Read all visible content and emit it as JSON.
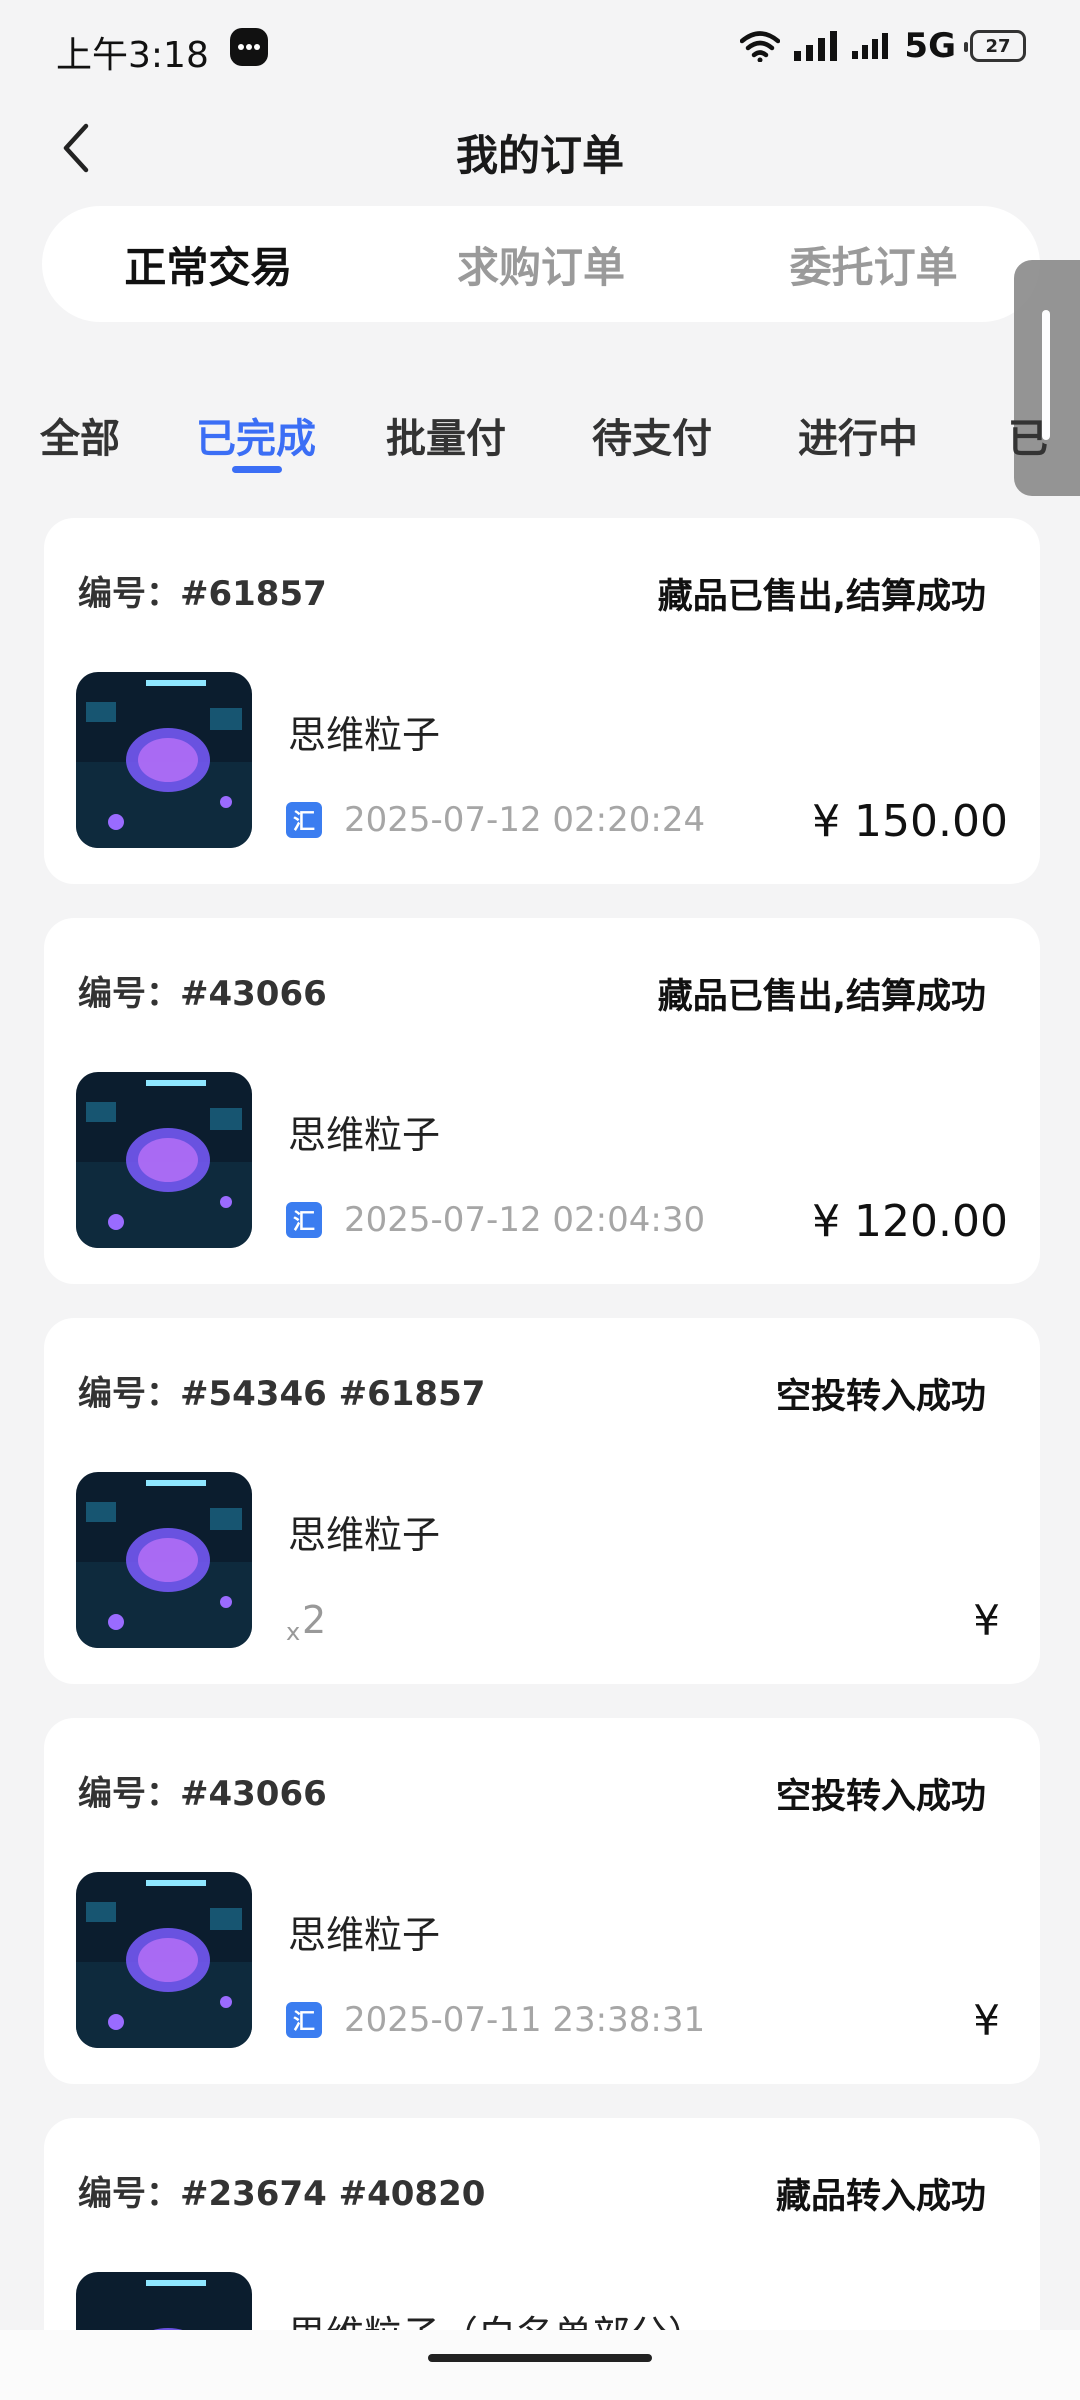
{
  "status_bar": {
    "time": "上午3:18",
    "network": "5G",
    "battery": "27"
  },
  "header": {
    "title": "我的订单",
    "back_icon": "chevron-left-icon"
  },
  "segment_tabs": [
    {
      "label": "正常交易",
      "active": true
    },
    {
      "label": "求购订单",
      "active": false
    },
    {
      "label": "委托订单",
      "active": false
    }
  ],
  "filter_tabs": [
    {
      "label": "全部",
      "active": false
    },
    {
      "label": "已完成",
      "active": true
    },
    {
      "label": "批量付",
      "active": false
    },
    {
      "label": "待支付",
      "active": false
    },
    {
      "label": "进行中",
      "active": false
    },
    {
      "label": "已",
      "active": false
    }
  ],
  "orders": [
    {
      "number": "编号：#61857",
      "status": "藏品已售出,结算成功",
      "item_name": "思维粒子",
      "badge": "汇",
      "date": "2025-07-12 02:20:24",
      "price": "¥ 150.00"
    },
    {
      "number": "编号：#43066",
      "status": "藏品已售出,结算成功",
      "item_name": "思维粒子",
      "badge": "汇",
      "date": "2025-07-12 02:04:30",
      "price": "¥ 120.00"
    },
    {
      "number": "编号：#54346 #61857",
      "status": "空投转入成功",
      "item_name": "思维粒子",
      "qty_prefix": "x",
      "qty": "2",
      "price": "¥"
    },
    {
      "number": "编号：#43066",
      "status": "空投转入成功",
      "item_name": "思维粒子",
      "badge": "汇",
      "date": "2025-07-11 23:38:31",
      "price": "¥"
    },
    {
      "number": "编号：#23674 #40820",
      "status": "藏品转入成功",
      "item_name": "思维粒子（白名单部分）"
    }
  ],
  "colors": {
    "accent": "#3b6ef5",
    "background": "#f4f4f5",
    "badge": "#3b7df0"
  }
}
